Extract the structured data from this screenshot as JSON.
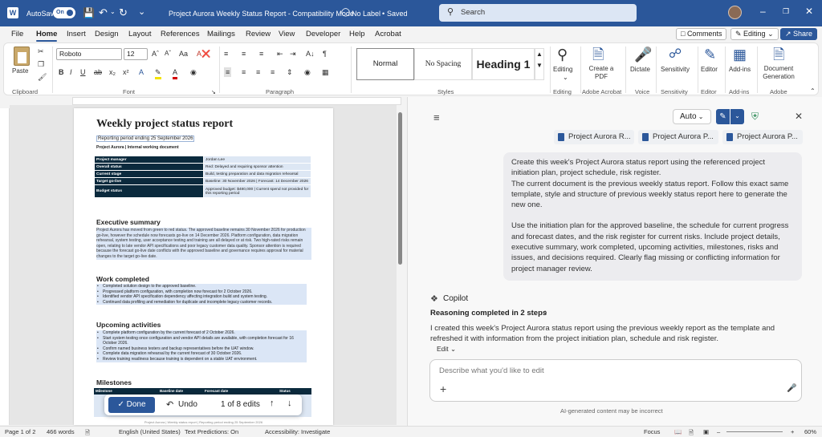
{
  "titlebar": {
    "autosave": "AutoSave",
    "autosave_state": "On",
    "doc_title": "Project Aurora Weekly Status Report  -  Compatibility Mode",
    "label": "No Label",
    "saved": "Saved",
    "search_placeholder": "Search"
  },
  "menu": {
    "items": [
      "File",
      "Home",
      "Insert",
      "Design",
      "Layout",
      "References",
      "Mailings",
      "Review",
      "View",
      "Developer",
      "Help",
      "Acrobat"
    ],
    "active": "Home",
    "comments": "Comments",
    "editing": "Editing",
    "share": "Share"
  },
  "ribbon": {
    "paste": "Paste",
    "clipboard": "Clipboard",
    "font_name": "Roboto",
    "font_size": "12",
    "font": "Font",
    "paragraph": "Paragraph",
    "styles_label": "Styles",
    "style_normal": "Normal",
    "style_nospacing": "No Spacing",
    "style_heading1": "Heading 1",
    "editing": "Editing",
    "create_pdf": "Create a PDF",
    "adobe_acrobat": "Adobe Acrobat",
    "dictate": "Dictate",
    "voice": "Voice",
    "sensitivity": "Sensitivity",
    "editor": "Editor",
    "addins": "Add-ins",
    "docgen": "Document Generation",
    "adobe": "Adobe"
  },
  "document": {
    "title": "Weekly project status report",
    "period": "Reporting period ending 25 September 2026",
    "project": "Project Aurora | Internal working document",
    "status_table": [
      [
        "Project manager",
        "Jordan Lee"
      ],
      [
        "Overall status",
        "Red: Delayed and requiring sponsor attention"
      ],
      [
        "Current stage",
        "Build, testing preparation and data migration rehearsal"
      ],
      [
        "Target go-live",
        "Baseline: 30 November 2026 | Forecast: 14 December 2026"
      ],
      [
        "Budget status",
        "Approved budget: $480,000 | Current spend not provided for this reporting period"
      ]
    ],
    "exec_heading": "Executive summary",
    "exec_text": "Project Aurora has moved from green to red status. The approved baseline remains 30 November 2026 for production go-live, however the schedule now forecasts go-live on 14 December 2026. Platform configuration, data migration rehearsal, system testing, user acceptance testing and training are all delayed or at risk. Two high-rated risks remain open, relating to late vendor API specifications and poor legacy customer data quality. Sponsor attention is required because the forecast go-live date conflicts with the approved baseline and governance requires approval for material changes to the target go-live date.",
    "work_heading": "Work completed",
    "work_items": [
      "Completed solution design to the approved baseline.",
      "Progressed platform configuration, with completion now forecast for 2 October 2026.",
      "Identified vendor API specification dependency affecting integration build and system testing.",
      "Continued data profiling and remediation for duplicate and incomplete legacy customer records."
    ],
    "upcoming_heading": "Upcoming activities",
    "upcoming_items": [
      "Complete platform configuration by the current forecast of 2 October 2026.",
      "Start system testing once configuration and vendor API details are available, with completion forecast for 16 October 2026.",
      "Confirm named business testers and backup representatives before the UAT window.",
      "Complete data migration rehearsal by the current forecast of 30 October 2026.",
      "Review training readiness because training is dependent on a stable UAT environment."
    ],
    "milestones_heading": "Milestones",
    "milestone_headers": [
      "Milestone",
      "Baseline date",
      "Forecast date",
      "Status"
    ],
    "footer": "Project Aurora | Weekly status report | Reporting period ending 25 September 2026"
  },
  "editbar": {
    "done": "Done",
    "undo": "Undo",
    "count": "1 of 8 edits"
  },
  "status": {
    "page": "Page 1 of 2",
    "words": "466 words",
    "language": "English (United States)",
    "predictions": "Text Predictions: On",
    "accessibility": "Accessibility: Investigate",
    "focus": "Focus",
    "zoom": "60%"
  },
  "copilot": {
    "mode": "Auto",
    "chips": [
      "Project Aurora R...",
      "Project Aurora P...",
      "Project Aurora P..."
    ],
    "prompt_p1": "Create this week's Project Aurora status report using the referenced project initiation plan, project schedule, risk register.",
    "prompt_p1b": "The current document is the previous weekly status report. Follow this exact same template, style and structure of previous weekly status report here to generate the new one.",
    "prompt_p2": "Use the initiation plan for the approved baseline, the schedule for current progress and forecast dates, and the risk register for current risks. Include project details, executive summary, work completed, upcoming activities, milestones, risks and issues, and decisions required. Clearly flag missing or conflicting information for project manager review.",
    "name": "Copilot",
    "reasoning": "Reasoning completed in 2 steps",
    "response": "I created this week's Project Aurora status report using the previous weekly report as the template and refreshed it with information from the project initiation plan, schedule and risk register.",
    "edit": "Edit",
    "input_placeholder": "Describe what you'd like to edit",
    "disclaimer": "AI-generated content may be incorrect"
  },
  "colors": {
    "brand": "#2b579a",
    "table_dark": "#0b2a3d",
    "table_light": "#dde7f4"
  }
}
